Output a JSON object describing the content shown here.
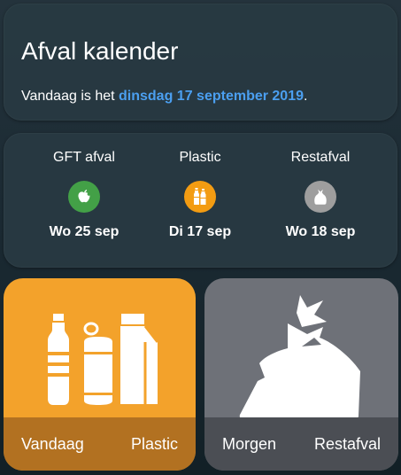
{
  "header": {
    "title": "Afval kalender",
    "today_prefix": "Vandaag is het ",
    "today_date": "dinsdag 17 september 2019",
    "today_suffix": "."
  },
  "schedule": [
    {
      "label": "GFT afval",
      "date": "Wo 25 sep",
      "icon": "apple-icon",
      "color": "#43a047"
    },
    {
      "label": "Plastic",
      "date": "Di 17 sep",
      "icon": "bottles-icon",
      "color": "#f39c12"
    },
    {
      "label": "Restafval",
      "date": "Wo 18 sep",
      "icon": "trash-bag-icon",
      "color": "#9e9e9e"
    }
  ],
  "tiles": {
    "today": {
      "when": "Vandaag",
      "type": "Plastic",
      "color": "#f3a22b"
    },
    "tomorrow": {
      "when": "Morgen",
      "type": "Restafval",
      "color": "#6e7178"
    }
  },
  "colors": {
    "accent_date": "#4b9ff0"
  }
}
